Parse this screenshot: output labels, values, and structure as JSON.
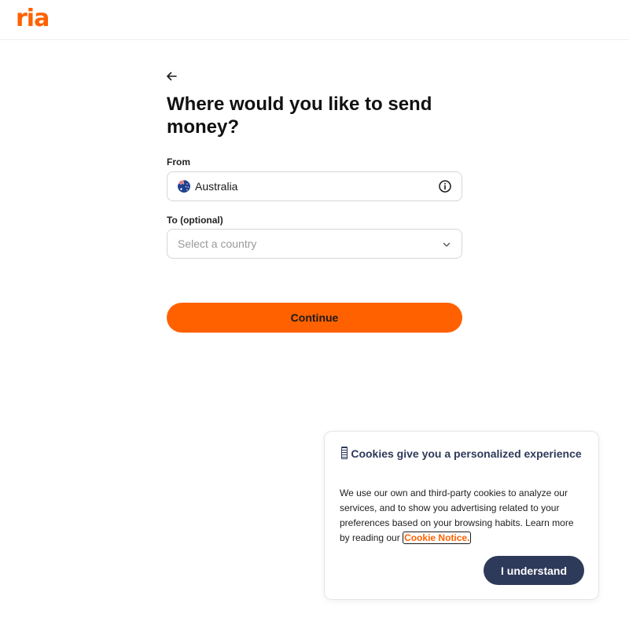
{
  "header": {
    "logo_text": "ria"
  },
  "main": {
    "title": "Where would you like to send money?",
    "from": {
      "label": "From",
      "value": "Australia",
      "flag_icon": "australia-flag-icon",
      "info_icon": "info-icon"
    },
    "to": {
      "label": "To (optional)",
      "placeholder": "Select a country",
      "chevron_icon": "chevron-down-icon"
    },
    "continue_label": "Continue"
  },
  "cookie_banner": {
    "title": "Cookies give you a personalized experience",
    "body": "We use our own and third-party cookies to analyze our services, and to show you advertising related to your preferences based on your browsing habits. Learn more by reading our",
    "link_text": "Cookie Notice.",
    "button_label": "I understand"
  },
  "colors": {
    "brand_orange": "#ff6100",
    "navy": "#2e3a5a"
  }
}
